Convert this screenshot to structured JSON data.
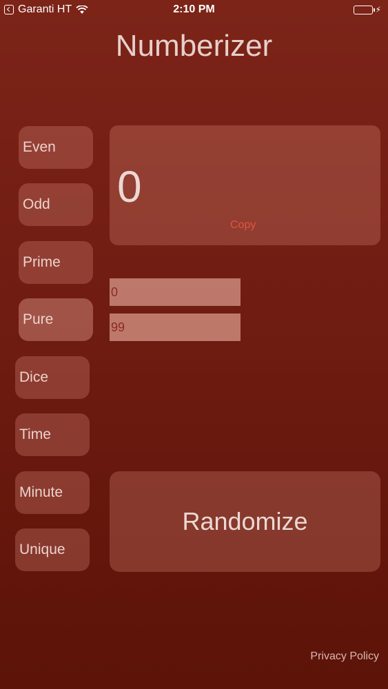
{
  "status_bar": {
    "carrier": "Garanti HT",
    "time": "2:10 PM"
  },
  "app": {
    "title": "Numberizer"
  },
  "modes": [
    {
      "label": "Even",
      "selected": false
    },
    {
      "label": "Odd",
      "selected": false
    },
    {
      "label": "Prime",
      "selected": false
    },
    {
      "label": "Pure",
      "selected": true
    },
    {
      "label": "Dice",
      "selected": false
    },
    {
      "label": "Time",
      "selected": false
    },
    {
      "label": "Minute",
      "selected": false
    },
    {
      "label": "Unique",
      "selected": false
    }
  ],
  "result": {
    "value": "0",
    "copy_label": "Copy"
  },
  "range": {
    "min_value": "0",
    "max_value": "99"
  },
  "actions": {
    "randomize_label": "Randomize",
    "privacy_label": "Privacy Policy"
  },
  "colors": {
    "background_top": "#7c2418",
    "background_bottom": "#5c1308",
    "accent_copy": "#e0553f",
    "battery": "#4cd964"
  }
}
